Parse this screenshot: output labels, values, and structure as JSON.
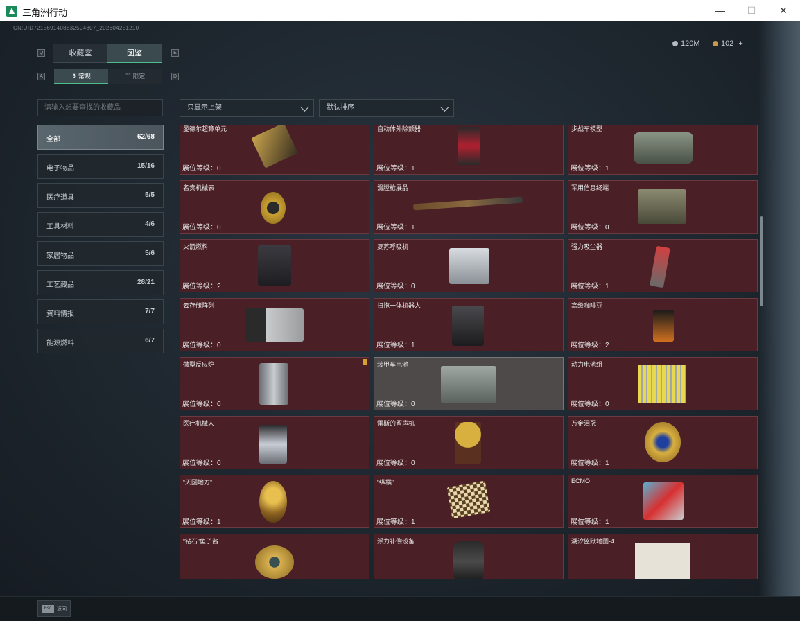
{
  "window": {
    "title": "三角洲行动",
    "min": "—",
    "max": "☐",
    "close": "✕"
  },
  "uid": "CN:UID7215691408832594807_202604251210",
  "currency": {
    "silver": "120M",
    "gold": "102",
    "add": "+"
  },
  "key_hints": {
    "q": "Q",
    "e": "E",
    "a": "A",
    "d": "D"
  },
  "tabs": [
    {
      "label": "收藏室"
    },
    {
      "label": "图鉴"
    }
  ],
  "subtabs": [
    {
      "label": "常规",
      "icon": "⚱"
    },
    {
      "label": "限定",
      "icon": "☷"
    }
  ],
  "search": {
    "placeholder": "请输入想要查找的收藏品"
  },
  "categories": [
    {
      "label": "全部",
      "count": "62/68"
    },
    {
      "label": "电子物品",
      "count": "15/16"
    },
    {
      "label": "医疗道具",
      "count": "5/5"
    },
    {
      "label": "工具材料",
      "count": "4/6"
    },
    {
      "label": "家居物品",
      "count": "5/6"
    },
    {
      "label": "工艺藏品",
      "count": "28/21"
    },
    {
      "label": "资料情报",
      "count": "7/7"
    },
    {
      "label": "能源燃料",
      "count": "6/7"
    }
  ],
  "filters": {
    "shelf": "只显示上架",
    "sort": "默认排序"
  },
  "items": [
    {
      "name": "曼德尔超算单元",
      "level": "展位等级：0"
    },
    {
      "name": "自动体外除颤器",
      "level": "展位等级：1"
    },
    {
      "name": "步战车模型",
      "level": "展位等级：1"
    },
    {
      "name": "名贵机械表",
      "level": "展位等级：0"
    },
    {
      "name": "滑膛枪展品",
      "level": "展位等级：1"
    },
    {
      "name": "军用信息终端",
      "level": "展位等级：0"
    },
    {
      "name": "火箭燃料",
      "level": "展位等级：2"
    },
    {
      "name": "复苏呼吸机",
      "level": "展位等级：0"
    },
    {
      "name": "强力吸尘器",
      "level": "展位等级：1"
    },
    {
      "name": "云存储阵列",
      "level": "展位等级：0"
    },
    {
      "name": "扫拖一体机器人",
      "level": "展位等级：1"
    },
    {
      "name": "高级咖啡豆",
      "level": "展位等级：2"
    },
    {
      "name": "微型反应炉",
      "level": "展位等级：0",
      "alert": "!"
    },
    {
      "name": "装甲车电池",
      "level": "展位等级：0"
    },
    {
      "name": "动力电池组",
      "level": "展位等级：0"
    },
    {
      "name": "医疗机械人",
      "level": "展位等级：0"
    },
    {
      "name": "雷斯的留声机",
      "level": "展位等级：0"
    },
    {
      "name": "万金泪冠",
      "level": "展位等级：1"
    },
    {
      "name": "“天圆地方”",
      "level": "展位等级：1"
    },
    {
      "name": "“纵横”",
      "level": "展位等级：1"
    },
    {
      "name": "ECMO",
      "level": "展位等级：1"
    },
    {
      "name": "“钻石”鱼子酱",
      "level": ""
    },
    {
      "name": "浮力补偿设备",
      "level": ""
    },
    {
      "name": "潮汐监狱地图-4",
      "level": ""
    }
  ],
  "footer": {
    "esc_key": "Esc",
    "back": "返回"
  },
  "colors": {
    "accent": "#4dbd8a",
    "card_bg": "#4a2026",
    "card_border": "#6a3a40"
  }
}
